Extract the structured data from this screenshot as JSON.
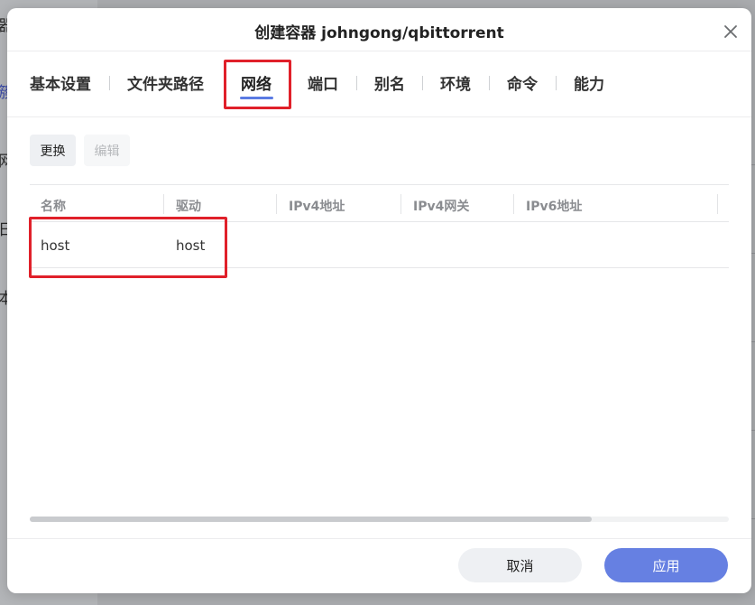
{
  "background": {
    "left_fragments": [
      "器",
      "簇",
      "网",
      "日",
      "本"
    ]
  },
  "dialog": {
    "title": "创建容器 johngong/qbittorrent",
    "close_icon": "close-icon"
  },
  "tabs": [
    {
      "label": "基本设置"
    },
    {
      "label": "文件夹路径"
    },
    {
      "label": "网络",
      "active": true
    },
    {
      "label": "端口"
    },
    {
      "label": "别名"
    },
    {
      "label": "环境"
    },
    {
      "label": "命令"
    },
    {
      "label": "能力"
    }
  ],
  "toolbar": {
    "change_label": "更换",
    "edit_label": "编辑"
  },
  "table": {
    "columns": [
      "名称",
      "驱动",
      "IPv4地址",
      "IPv4网关",
      "IPv6地址"
    ],
    "rows": [
      {
        "name": "host",
        "driver": "host"
      }
    ]
  },
  "footer": {
    "cancel_label": "取消",
    "apply_label": "应用"
  },
  "colors": {
    "accent": "#6680e2",
    "tab_underline": "#5b7be3",
    "annotation": "#e0202a"
  }
}
